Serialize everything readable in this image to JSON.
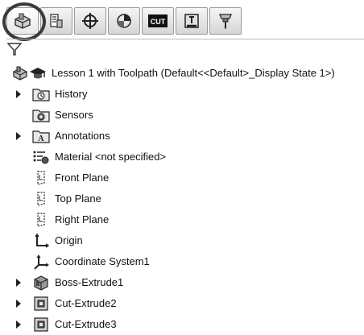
{
  "tabs": [
    {
      "name": "FeatureManager design tree",
      "icon": "feature-manager-icon",
      "active": true
    },
    {
      "name": "PropertyManager",
      "icon": "property-manager-icon",
      "active": false
    },
    {
      "name": "ConfigurationManager",
      "icon": "configuration-manager-icon",
      "active": false
    },
    {
      "name": "DimXpertManager",
      "icon": "dimxpert-icon",
      "active": false
    },
    {
      "name": "CAM Feature Tree",
      "icon": "cam-icon",
      "icon_text": "CUT",
      "active": false
    },
    {
      "name": "CAM Operation Tree",
      "icon": "cam-operation-icon",
      "active": false
    },
    {
      "name": "CAM Tool Tree",
      "icon": "cam-tool-icon",
      "active": false
    }
  ],
  "tree": {
    "root_label": "Lesson 1 with Toolpath  (Default<<Default>_Display State 1>)",
    "items": [
      {
        "label": "History",
        "icon": "history-folder-icon",
        "expandable": true
      },
      {
        "label": "Sensors",
        "icon": "sensors-folder-icon",
        "expandable": false
      },
      {
        "label": "Annotations",
        "icon": "annotations-folder-icon",
        "expandable": true
      },
      {
        "label": "Material <not specified>",
        "icon": "material-icon",
        "expandable": false
      },
      {
        "label": "Front Plane",
        "icon": "plane-icon",
        "expandable": false
      },
      {
        "label": "Top Plane",
        "icon": "plane-icon",
        "expandable": false
      },
      {
        "label": "Right Plane",
        "icon": "plane-icon",
        "expandable": false
      },
      {
        "label": "Origin",
        "icon": "origin-icon",
        "expandable": false
      },
      {
        "label": "Coordinate System1",
        "icon": "coordinate-system-icon",
        "expandable": false
      },
      {
        "label": "Boss-Extrude1",
        "icon": "boss-extrude-icon",
        "expandable": true
      },
      {
        "label": "Cut-Extrude2",
        "icon": "cut-extrude-icon",
        "expandable": true
      },
      {
        "label": "Cut-Extrude3",
        "icon": "cut-extrude-icon",
        "expandable": true
      }
    ]
  }
}
